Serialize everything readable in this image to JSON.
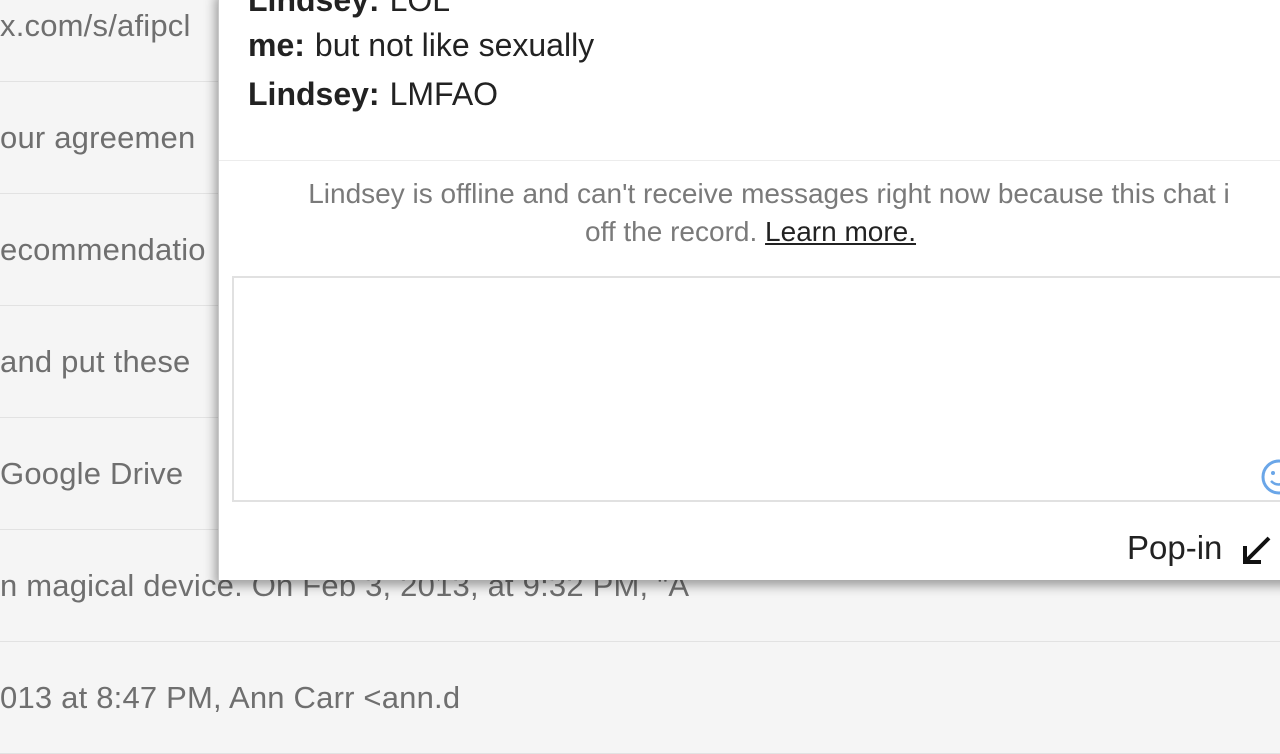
{
  "inbox": {
    "rows": [
      {
        "snippet": "x.com/s/afipcl"
      },
      {
        "snippet": "our agreemen"
      },
      {
        "snippet": "ecommendatio"
      },
      {
        "snippet": "and put these"
      },
      {
        "snippet": " Google Drive"
      },
      {
        "snippet": "n magical device. On Feb 3, 2013, at 9:32 PM, \"A"
      },
      {
        "snippet": "013 at 8:47 PM, Ann Carr <ann.d"
      }
    ]
  },
  "chat": {
    "messages": [
      {
        "sender": "Lindsey:",
        "text": "LOL"
      },
      {
        "sender": "me:",
        "text": "but not like sexually"
      },
      {
        "sender": "Lindsey:",
        "text": "LMFAO"
      }
    ],
    "offline_note_line1": "Lindsey is offline and can't receive messages right now because this chat i",
    "offline_note_line2": "off the record.",
    "learn_more_label": "Learn more.",
    "popin_label": "Pop-in",
    "emoji_icon": "smiley-icon",
    "popin_icon": "arrow-down-left-icon"
  }
}
